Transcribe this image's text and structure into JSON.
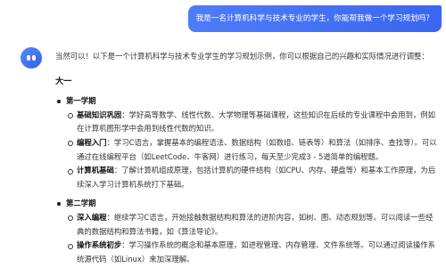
{
  "user_message": "我是一名计算机科学与技术专业的学生，你能帮我做一个学习规划吗？",
  "assistant": {
    "intro": "当然可以！以下是一个计算机科学与技术专业学生的学习规划示例，你可以根据自己的兴趣和实际情况进行调整：",
    "year_title": "大一",
    "semesters": [
      {
        "title": "第一学期",
        "items": [
          {
            "keyword": "基础知识巩固",
            "text": "：学好高等数学、线性代数、大学物理等基础课程，这些知识在后续的专业课程中会用到，例如在计算机图形学中会用到线性代数的知识。"
          },
          {
            "keyword": "编程入门",
            "text": "：学习C语言，掌握基本的编程语法、数据结构（如数组、链表等）和算法（如排序、查找等）。可以通过在线编程平台（如LeetCode、牛客网）进行练习，每天至少完成3 - 5道简单的编程题。"
          },
          {
            "keyword": "计算机基础",
            "text": "：了解计算机组成原理，包括计算机的硬件结构（如CPU、内存、硬盘等）和基本工作原理，为后续深入学习计算机系统打下基础。"
          }
        ]
      },
      {
        "title": "第二学期",
        "items": [
          {
            "keyword": "深入编程",
            "text": "：继续学习C语言，开始接触数据结构和算法的进阶内容，如树、图、动态规划等。可以阅读一些经典的数据结构和算法书籍，如《算法导论》。"
          },
          {
            "keyword": "操作系统初步",
            "text": "：学习操作系统的概念和基本原理，如进程管理、内存管理、文件系统等。可以通过阅读操作系统源代码（如Linux）来加深理解。"
          }
        ]
      }
    ]
  }
}
